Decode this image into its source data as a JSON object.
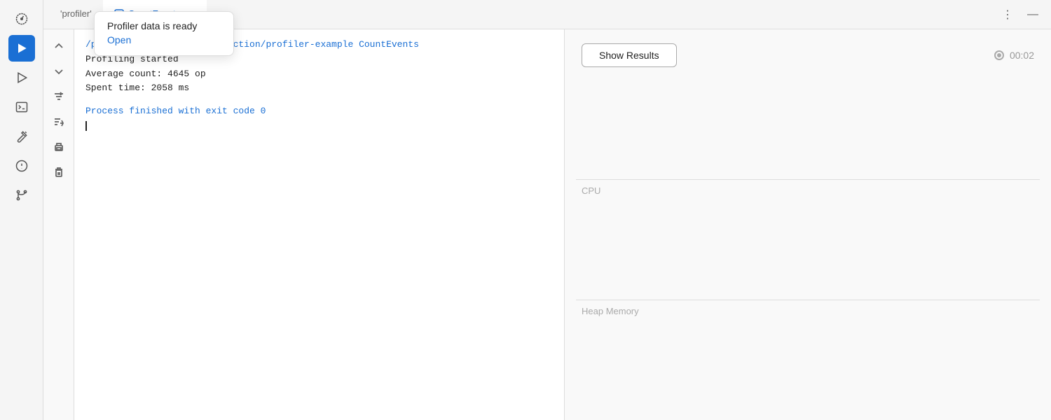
{
  "sidebar": {
    "items": [
      {
        "id": "gauge",
        "label": "Gauge",
        "icon": "gauge",
        "active": false
      },
      {
        "id": "run",
        "label": "Run",
        "icon": "play",
        "active": true
      },
      {
        "id": "build",
        "label": "Build",
        "icon": "play-outline",
        "active": false
      },
      {
        "id": "terminal",
        "label": "Terminal",
        "icon": "terminal",
        "active": false
      },
      {
        "id": "hammer",
        "label": "Build Tools",
        "icon": "hammer",
        "active": false
      },
      {
        "id": "warning",
        "label": "Problems",
        "icon": "warning",
        "active": false
      },
      {
        "id": "git",
        "label": "Git",
        "icon": "git",
        "active": false
      }
    ]
  },
  "tabbar": {
    "inactive_tab": "'profiler'",
    "active_tab": "CountEvents",
    "more_icon": "⋮",
    "minimize_icon": "—"
  },
  "vtoolbar": {
    "buttons": [
      {
        "id": "scroll-up",
        "label": "Scroll Up"
      },
      {
        "id": "scroll-down",
        "label": "Scroll Down"
      },
      {
        "id": "filter",
        "label": "Filter"
      },
      {
        "id": "sort-down",
        "label": "Sort Down"
      },
      {
        "id": "print",
        "label": "Print"
      },
      {
        "id": "delete",
        "label": "Delete"
      }
    ]
  },
  "console": {
    "lines": [
      {
        "type": "blue",
        "text": "/profiler-example/out/production/profiler-example CountEvents"
      },
      {
        "type": "black",
        "text": "Profiling started"
      },
      {
        "type": "black",
        "text": "Average count: 4645 op"
      },
      {
        "type": "black",
        "text": "Spent time: 2058 ms"
      },
      {
        "type": "blank",
        "text": ""
      },
      {
        "type": "blue",
        "text": "Process finished with exit code 0"
      }
    ]
  },
  "right_panel": {
    "show_results_label": "Show Results",
    "timer_label": "00:02",
    "cpu_label": "CPU",
    "heap_memory_label": "Heap Memory"
  },
  "tooltip": {
    "title": "Profiler data is ready",
    "link_label": "Open"
  }
}
